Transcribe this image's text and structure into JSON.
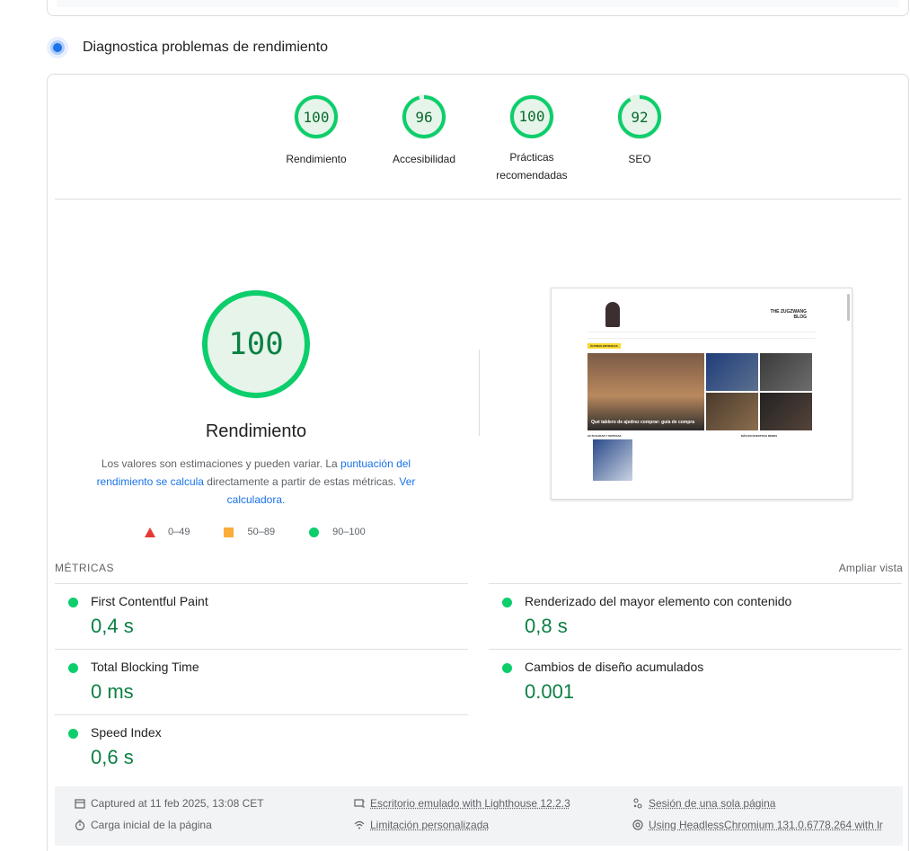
{
  "section": {
    "title": "Diagnostica problemas de rendimiento"
  },
  "gauges": [
    {
      "score": "100",
      "label": "Rendimiento"
    },
    {
      "score": "96",
      "label": "Accesibilidad"
    },
    {
      "score": "100",
      "label": "Prácticas recomendadas"
    },
    {
      "score": "92",
      "label": "SEO"
    }
  ],
  "performance": {
    "score": "100",
    "title": "Rendimiento",
    "desc_1": "Los valores son estimaciones y pueden variar. La ",
    "desc_link_1": "puntuación del rendimiento se calcula",
    "desc_2": " directamente a partir de estas métricas. ",
    "desc_link_2": "Ver calculadora.",
    "legend": {
      "fail": "0–49",
      "average": "50–89",
      "pass": "90–100"
    }
  },
  "screenshot": {
    "brand_line1": "THE ZUGZWANG",
    "brand_line2": "BLOG",
    "news_tag": "ÚLTIMAS ENTRADAS",
    "main_caption": "Qué tablero de ajedrez comprar: guía de compra",
    "bottom_left": "ACTUALIDAD Y NOTICIAS",
    "bottom_right": "MÁS EN NUESTRAS REDES"
  },
  "metrics": {
    "heading": "MÉTRICAS",
    "toggle": "Ampliar vista",
    "items": [
      {
        "name": "First Contentful Paint",
        "value": "0,4 s"
      },
      {
        "name": "Renderizado del mayor elemento con contenido",
        "value": "0,8 s"
      },
      {
        "name": "Total Blocking Time",
        "value": "0 ms"
      },
      {
        "name": "Cambios de diseño acumulados",
        "value": "0.001"
      },
      {
        "name": "Speed Index",
        "value": "0,6 s"
      }
    ]
  },
  "runtime": {
    "captured": "Captured at 11 feb 2025, 13:08 CET",
    "load": "Carga inicial de la página",
    "device": "Escritorio emulado with Lighthouse 12.2.3",
    "throttling": "Limitación personalizada",
    "session": "Sesión de una sola página",
    "browser": "Using HeadlessChromium 131.0.6778.264 with lr"
  },
  "colors": {
    "pass": "#0cce6b",
    "pass_text": "#0b8043",
    "link": "#1a73e8",
    "fail": "#e53935",
    "average": "#fbad3b"
  }
}
